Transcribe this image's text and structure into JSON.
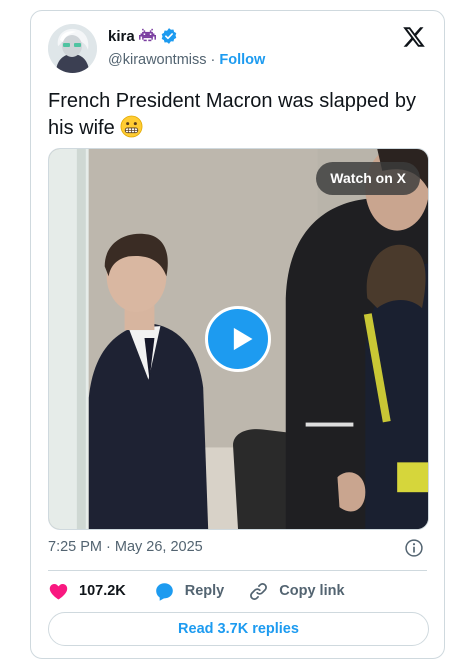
{
  "author": {
    "name": "kira",
    "handle": "@kirawontmiss",
    "separator": "·",
    "follow_label": "Follow"
  },
  "tweet": {
    "text": "French President Macron was slapped by his wife"
  },
  "media": {
    "watch_label": "Watch on X"
  },
  "meta": {
    "timestamp": "7:25 PM · May 26, 2025"
  },
  "actions": {
    "likes": "107.2K",
    "reply_label": "Reply",
    "copy_label": "Copy link"
  },
  "footer": {
    "read_replies": "Read 3.7K replies"
  },
  "colors": {
    "accent": "#1d9bf0",
    "like": "#f91880",
    "text": "#0f1419",
    "muted": "#536471",
    "border": "#cfd9de"
  }
}
